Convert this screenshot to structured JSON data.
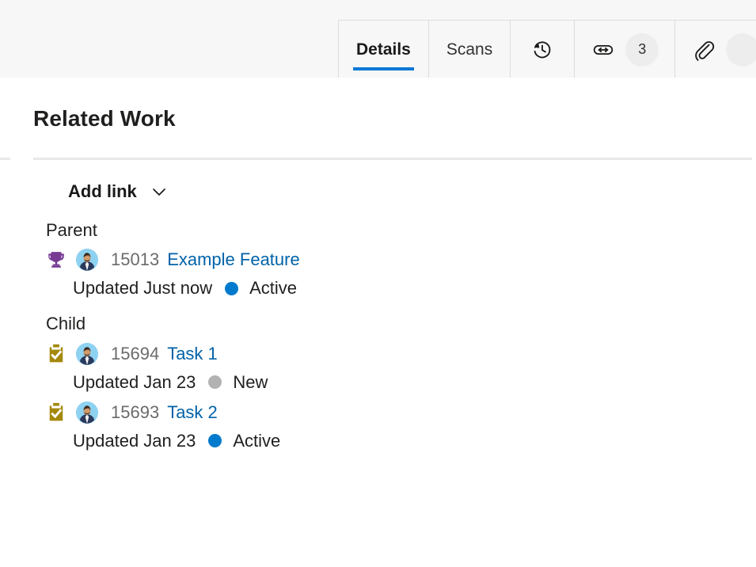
{
  "tabstrip": {
    "tabs": [
      {
        "label": "Details",
        "icon": null,
        "badge": null,
        "active": true
      },
      {
        "label": "Scans",
        "icon": null,
        "badge": null,
        "active": false
      },
      {
        "label": "",
        "icon": "history-icon",
        "badge": null,
        "active": false
      },
      {
        "label": "",
        "icon": "link-icon",
        "badge": "3",
        "active": false
      },
      {
        "label": "",
        "icon": "attachment-icon",
        "badge": "",
        "active": false
      }
    ],
    "active_underline_color": "#0078d4"
  },
  "main": {
    "page_title": "Related Work",
    "add_link": {
      "label": "Add link",
      "chevron_icon": "chevron-down-icon"
    },
    "groups": [
      {
        "label": "Parent",
        "items": [
          {
            "type_icon": "trophy-icon",
            "type_icon_color": "#773b93",
            "avatar_icon": "user-avatar",
            "id": "15013",
            "title": "Example Feature",
            "title_color": "#0062a8",
            "updated": "Updated Just now",
            "state": "Active",
            "state_color": "#007acc"
          }
        ]
      },
      {
        "label": "Child",
        "items": [
          {
            "type_icon": "task-icon",
            "type_icon_color": "#a4880a",
            "avatar_icon": "user-avatar",
            "id": "15694",
            "title": "Task 1",
            "title_color": "#0062a8",
            "updated": "Updated Jan 23",
            "state": "New",
            "state_color": "#b2b2b2"
          },
          {
            "type_icon": "task-icon",
            "type_icon_color": "#a4880a",
            "avatar_icon": "user-avatar",
            "id": "15693",
            "title": "Task 2",
            "title_color": "#0062a8",
            "updated": "Updated Jan 23",
            "state": "Active",
            "state_color": "#007acc"
          }
        ]
      }
    ]
  }
}
